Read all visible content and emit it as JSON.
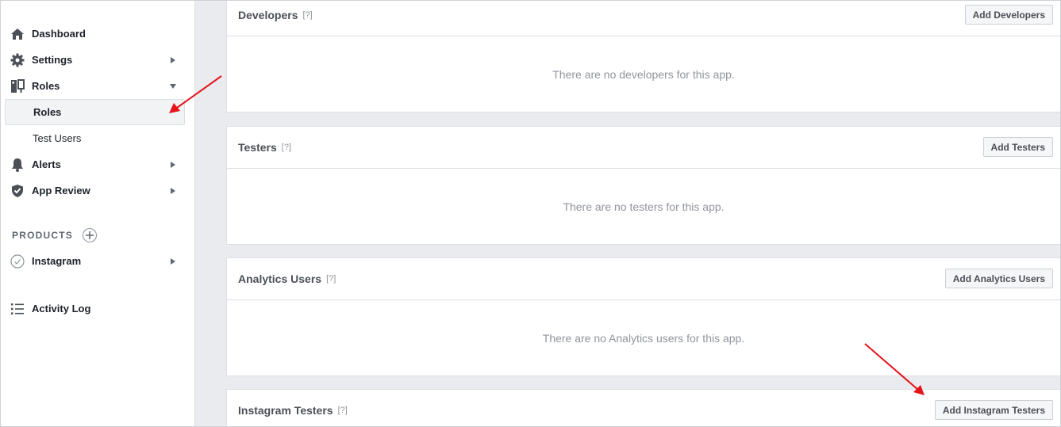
{
  "sidebar": {
    "items": [
      {
        "label": "Dashboard",
        "icon": "home-icon"
      },
      {
        "label": "Settings",
        "icon": "gear-icon"
      },
      {
        "label": "Roles",
        "icon": "roles-icon"
      },
      {
        "label": "Alerts",
        "icon": "bell-icon"
      },
      {
        "label": "App Review",
        "icon": "shield-check-icon"
      },
      {
        "label": "Instagram",
        "icon": "check-circle-icon"
      },
      {
        "label": "Activity Log",
        "icon": "list-icon"
      }
    ],
    "sub_items": [
      {
        "label": "Roles",
        "active": true
      },
      {
        "label": "Test Users",
        "active": false
      }
    ],
    "products_label": "PRODUCTS"
  },
  "panels": [
    {
      "title": "Developers",
      "help": "[?]",
      "button": "Add Developers",
      "empty": "There are no developers for this app."
    },
    {
      "title": "Testers",
      "help": "[?]",
      "button": "Add Testers",
      "empty": "There are no testers for this app."
    },
    {
      "title": "Analytics Users",
      "help": "[?]",
      "button": "Add Analytics Users",
      "empty": "There are no Analytics users for this app."
    },
    {
      "title": "Instagram Testers",
      "help": "[?]",
      "button": "Add Instagram Testers"
    }
  ],
  "colors": {
    "annotation_arrow": "#e5141b",
    "background": "#e9ebee",
    "active_bg": "#f2f3f5"
  }
}
